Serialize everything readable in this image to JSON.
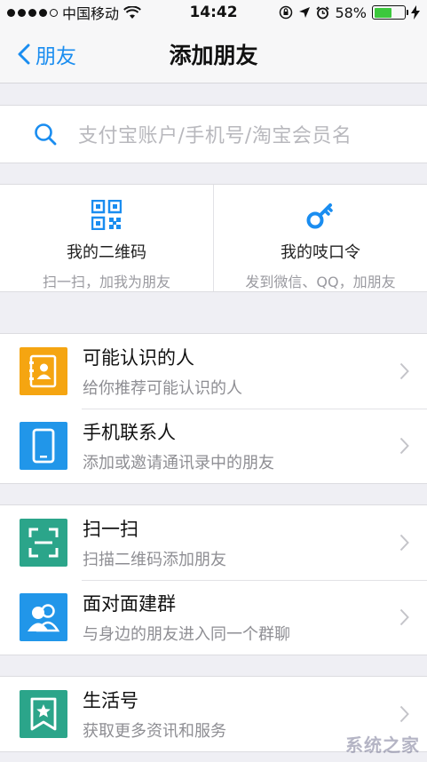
{
  "status": {
    "carrier": "中国移动",
    "time": "14:42",
    "battery": "58%",
    "battery_level": 0.58
  },
  "nav": {
    "back_label": "朋友",
    "title": "添加朋友"
  },
  "search": {
    "placeholder": "支付宝账户/手机号/淘宝会员名"
  },
  "quick": [
    {
      "title": "我的二维码",
      "subtitle": "扫一扫，加我为朋友",
      "icon": "qr-code-icon"
    },
    {
      "title": "我的吱口令",
      "subtitle": "发到微信、QQ，加朋友",
      "icon": "key-icon"
    }
  ],
  "rows": [
    {
      "title": "可能认识的人",
      "subtitle": "给你推荐可能认识的人",
      "icon": "contact-book-icon",
      "color": "#f5a511"
    },
    {
      "title": "手机联系人",
      "subtitle": "添加或邀请通讯录中的朋友",
      "icon": "phone-icon",
      "color": "#2196e9"
    },
    {
      "title": "扫一扫",
      "subtitle": "扫描二维码添加朋友",
      "icon": "scan-icon",
      "color": "#2ba58a"
    },
    {
      "title": "面对面建群",
      "subtitle": "与身边的朋友进入同一个群聊",
      "icon": "group-icon",
      "color": "#2196e9"
    },
    {
      "title": "生活号",
      "subtitle": "获取更多资讯和服务",
      "icon": "bookmark-star-icon",
      "color": "#2ba58a"
    }
  ],
  "watermark": "系统之家",
  "colors": {
    "accent": "#1a8df0"
  }
}
